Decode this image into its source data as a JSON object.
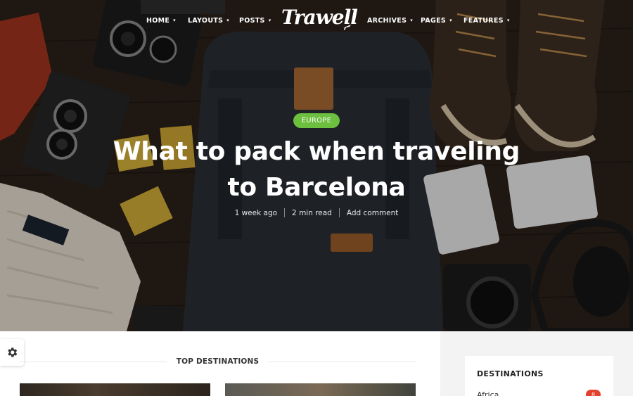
{
  "nav": {
    "items": [
      {
        "label": "HOME"
      },
      {
        "label": "LAYOUTS"
      },
      {
        "label": "POSTS"
      },
      {
        "label": "ARCHIVES"
      },
      {
        "label": "PAGES"
      },
      {
        "label": "FEATURES"
      }
    ],
    "logo": "Trawell"
  },
  "hero": {
    "category": "EUROPE",
    "title_line1": "What to pack when traveling",
    "title_line2": "to Barcelona",
    "meta": {
      "date": "1 week ago",
      "read_time": "2 min read",
      "comments": "Add comment"
    }
  },
  "main": {
    "section_title": "TOP DESTINATIONS"
  },
  "sidebar": {
    "widget_title": "DESTINATIONS",
    "items": [
      {
        "name": "Africa",
        "count": "8"
      }
    ]
  },
  "colors": {
    "accent_green": "#6cbf3f",
    "badge_red": "#e3412e"
  }
}
